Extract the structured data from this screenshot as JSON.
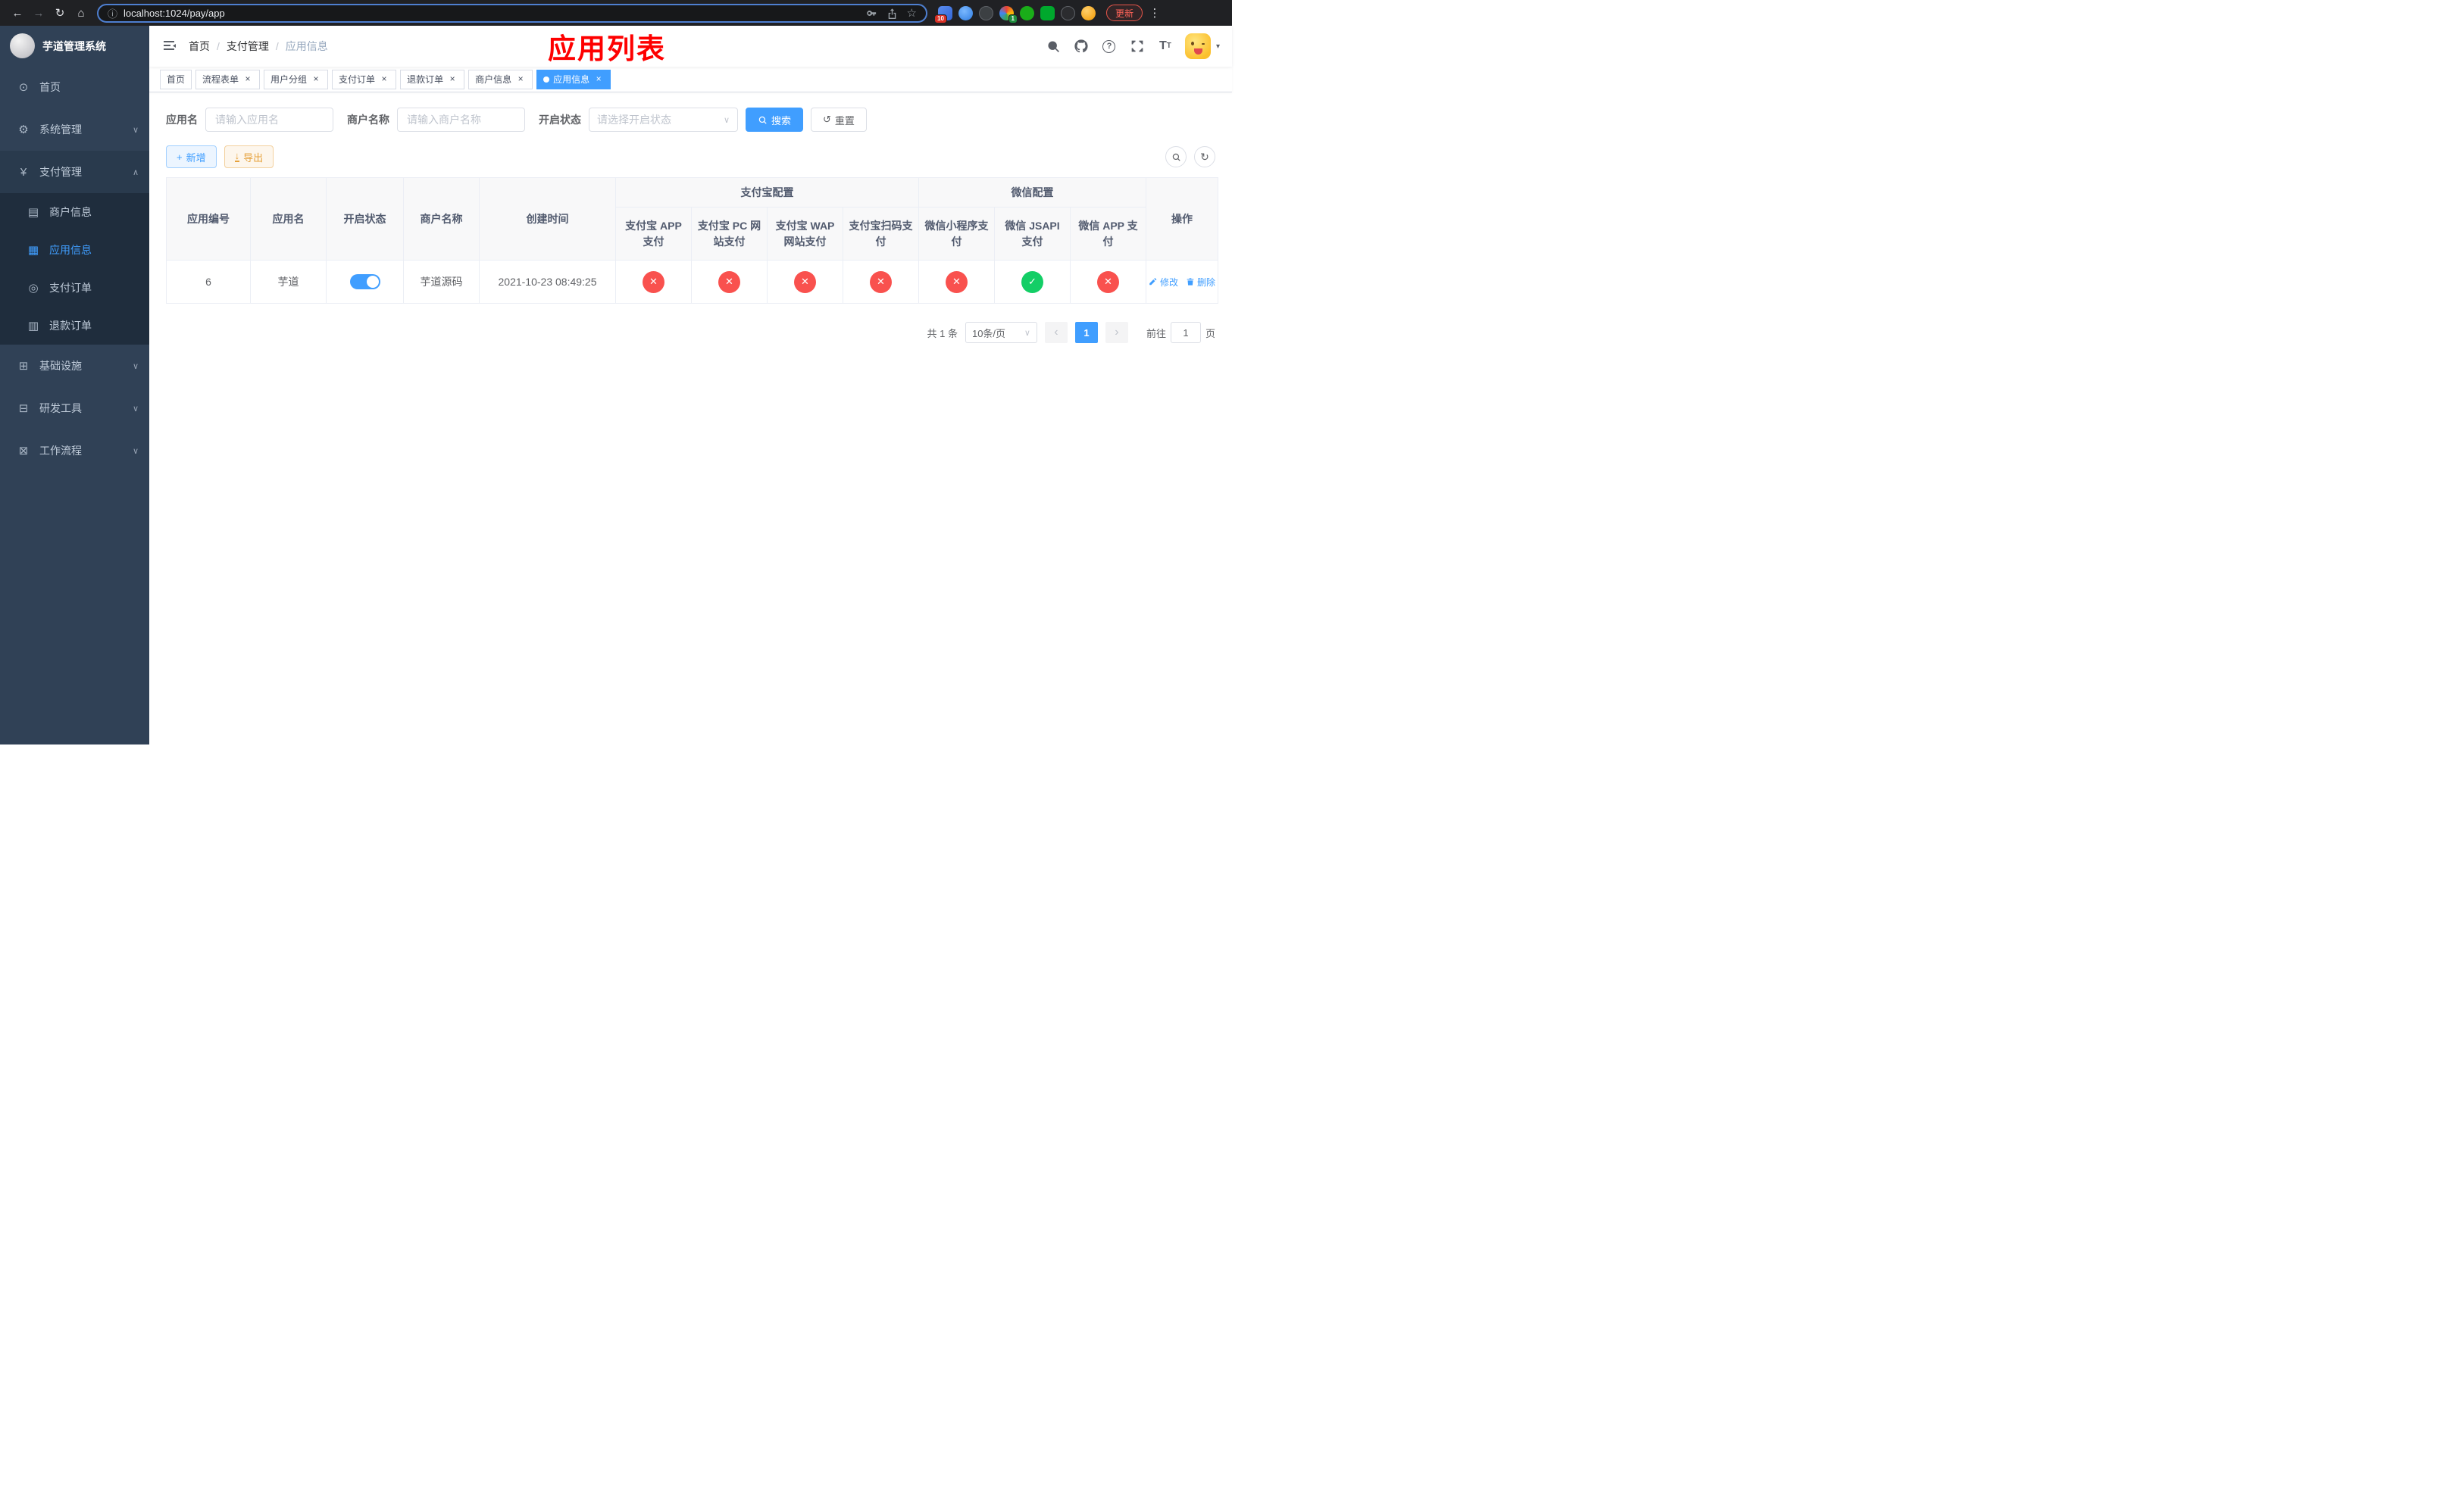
{
  "browser": {
    "url": "localhost:1024/pay/app",
    "update_button": "更新",
    "ext_badge_blue": "10",
    "ext_badge_green": "1"
  },
  "sidebar": {
    "logo_title": "芋道管理系统",
    "menu": [
      {
        "label": "首页"
      },
      {
        "label": "系统管理"
      },
      {
        "label": "支付管理"
      },
      {
        "label": "基础设施"
      },
      {
        "label": "研发工具"
      },
      {
        "label": "工作流程"
      }
    ],
    "pay_submenu": [
      {
        "label": "商户信息"
      },
      {
        "label": "应用信息"
      },
      {
        "label": "支付订单"
      },
      {
        "label": "退款订单"
      }
    ]
  },
  "header": {
    "breadcrumb": [
      "首页",
      "支付管理",
      "应用信息"
    ],
    "overlay_title": "应用列表"
  },
  "tabs": [
    {
      "label": "首页"
    },
    {
      "label": "流程表单"
    },
    {
      "label": "用户分组"
    },
    {
      "label": "支付订单"
    },
    {
      "label": "退款订单"
    },
    {
      "label": "商户信息"
    },
    {
      "label": "应用信息"
    }
  ],
  "filters": {
    "app_name_label": "应用名",
    "app_name_placeholder": "请输入应用名",
    "merchant_label": "商户名称",
    "merchant_placeholder": "请输入商户名称",
    "status_label": "开启状态",
    "status_placeholder": "请选择开启状态",
    "search_button": "搜索",
    "reset_button": "重置"
  },
  "toolbar": {
    "add_button": "新增",
    "export_button": "导出"
  },
  "table": {
    "headers": {
      "app_id": "应用编号",
      "app_name": "应用名",
      "status": "开启状态",
      "merchant": "商户名称",
      "created": "创建时间",
      "alipay_group": "支付宝配置",
      "wechat_group": "微信配置",
      "actions": "操作",
      "sub": [
        "支付宝 APP 支付",
        "支付宝 PC 网站支付",
        "支付宝 WAP 网站支付",
        "支付宝扫码支付",
        "微信小程序支付",
        "微信 JSAPI 支付",
        "微信 APP 支付"
      ]
    },
    "rows": [
      {
        "app_id": "6",
        "app_name": "芋道",
        "status_on": true,
        "merchant": "芋道源码",
        "created": "2021-10-23 08:49:25",
        "configs": [
          "off",
          "off",
          "off",
          "off",
          "off",
          "on",
          "off"
        ],
        "edit": "修改",
        "delete": "删除"
      }
    ]
  },
  "pagination": {
    "total": "共 1 条",
    "page_size": "10条/页",
    "page": "1",
    "goto": "前往",
    "goto_value": "1",
    "unit": "页"
  },
  "colors": {
    "accent": "#409eff",
    "danger": "#f9514e",
    "success": "#13ce66",
    "warning": "#e6a23c"
  },
  "icons": {
    "back": "←",
    "forward": "→",
    "reload": "↻",
    "home": "⌂",
    "info": "ⓘ",
    "star": "☆",
    "kebab": "⋮",
    "dashboard": "⊙",
    "gear": "⚙",
    "yen": "¥",
    "merchant": "▤",
    "app_grid": "▦",
    "pay_order": "◎",
    "refund": "▥",
    "infra": "⊞",
    "tools": "⊟",
    "workflow": "⊠",
    "chevron_down": "∨",
    "chevron_up": "∧",
    "caret_down": "▾",
    "plus": "+",
    "download": "↓",
    "reset": "↺",
    "refresh": "↻",
    "check": "✓",
    "cross": "✕",
    "close": "×",
    "prev": "‹",
    "next": "›",
    "question": "?",
    "text_size": "T"
  }
}
